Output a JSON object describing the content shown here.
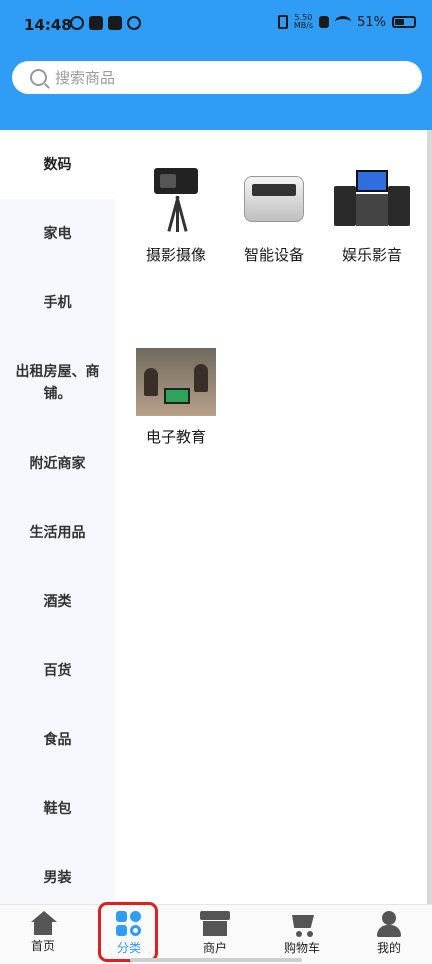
{
  "status_bar": {
    "time": "14:48",
    "net_speed_value": "5.50",
    "net_speed_unit": "MB/s",
    "battery": "51%",
    "battery_level": 0.51
  },
  "search": {
    "placeholder": "搜索商品"
  },
  "sidebar": {
    "items": [
      {
        "label": "数码",
        "active": true
      },
      {
        "label": "家电"
      },
      {
        "label": "手机"
      },
      {
        "label": "出租房屋、商铺。"
      },
      {
        "label": "附近商家"
      },
      {
        "label": "生活用品"
      },
      {
        "label": "酒类"
      },
      {
        "label": "百货"
      },
      {
        "label": "食品"
      },
      {
        "label": "鞋包"
      },
      {
        "label": "男装"
      }
    ]
  },
  "categories": [
    {
      "label": "摄影摄像",
      "icon": "camera-icon"
    },
    {
      "label": "智能设备",
      "icon": "smart-device-icon"
    },
    {
      "label": "娱乐影音",
      "icon": "audio-video-icon"
    },
    {
      "label": "电子教育",
      "icon": "education-icon"
    }
  ],
  "bottom_nav": {
    "items": [
      {
        "label": "首页",
        "icon": "home-icon"
      },
      {
        "label": "分类",
        "icon": "category-icon",
        "active": true
      },
      {
        "label": "商户",
        "icon": "shop-icon"
      },
      {
        "label": "购物车",
        "icon": "cart-icon"
      },
      {
        "label": "我的",
        "icon": "profile-icon"
      }
    ]
  },
  "colors": {
    "accent": "#2f9cf6",
    "highlight_box": "#e02020",
    "sidebar_bg": "#f5f9fd"
  }
}
